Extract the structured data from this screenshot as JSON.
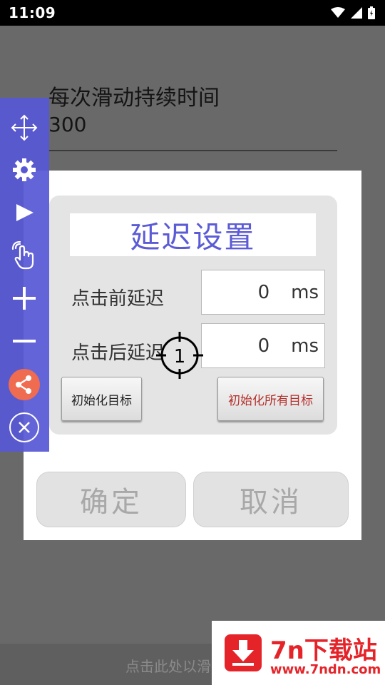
{
  "status_bar": {
    "time": "11:09",
    "icons": [
      "wifi-icon",
      "signal-icon",
      "battery-icon"
    ]
  },
  "background": {
    "setting_label": "每次滑动持续时间",
    "setting_value": "300",
    "bottom_hint": "点击此处以滑"
  },
  "dialog": {
    "title": "延迟设置",
    "rows": [
      {
        "label": "点击前延迟",
        "value": "0",
        "unit": "ms"
      },
      {
        "label": "点击后延迟",
        "value": "0",
        "unit": "ms"
      }
    ],
    "init_target_label": "初始化目标",
    "init_all_label": "初始化所有目标",
    "confirm_label": "确定",
    "cancel_label": "取消"
  },
  "crosshair": {
    "label": "1"
  },
  "toolbar": {
    "icons": [
      "move-icon",
      "gear-icon",
      "play-icon",
      "hand-tap-icon",
      "plus-icon",
      "minus-icon",
      "share-icon",
      "close-icon"
    ],
    "accent": "#5858d6",
    "share_color": "#ef6c50"
  },
  "watermark": {
    "name": "7n下载站",
    "url": "www.7ndn.com",
    "color": "#e5242a"
  }
}
